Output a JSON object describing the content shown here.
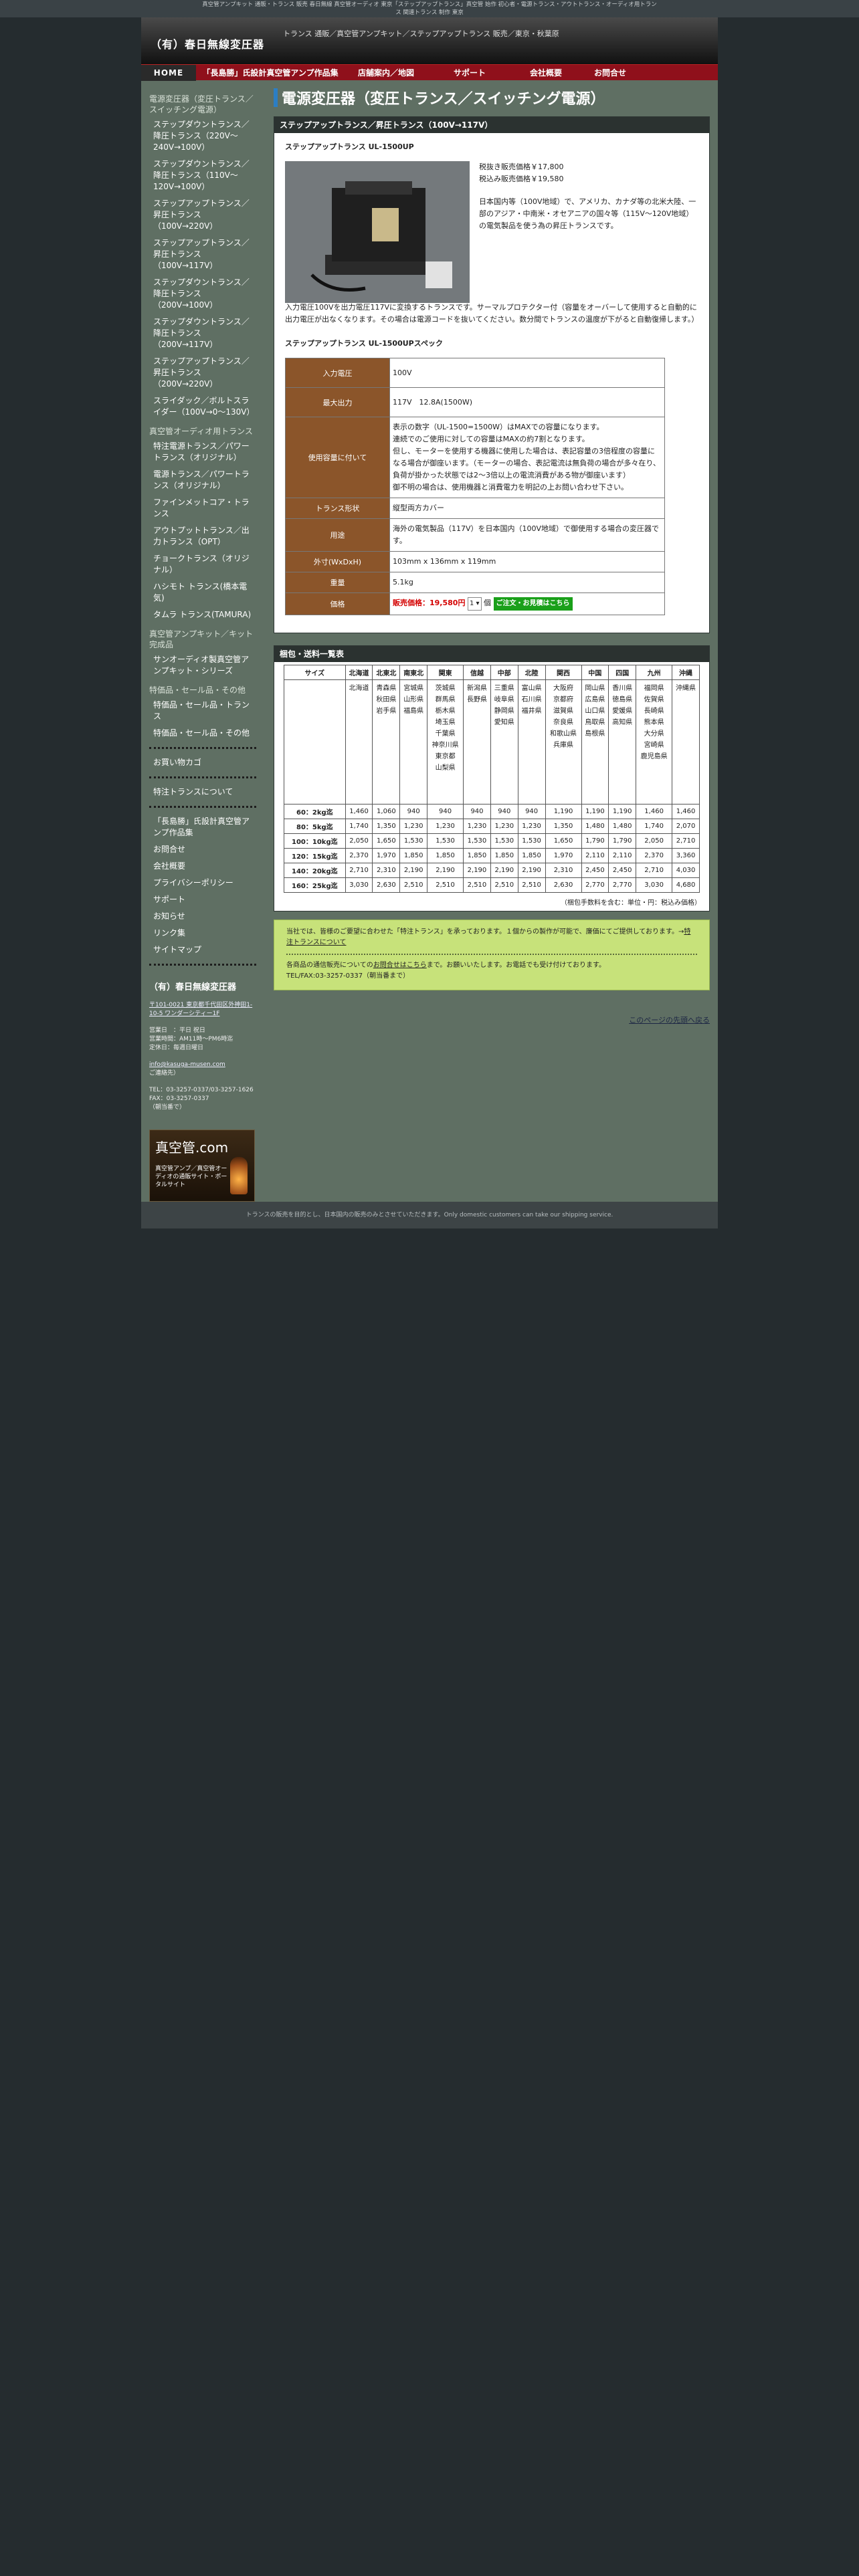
{
  "top_bar": "真空管アンプキット 通販・トランス 販売 春日無線 真空管オーディオ 東京「ステップアップトランス」真空管 始作 初心者・電源トランス・アウトトランス・オーディオ用トランス 関連トランス 制作 東京",
  "site_title": "（有）春日無線変圧器",
  "header_desc": "トランス 通販／真空管アンプキット／ステップアップトランス 販売／東京・秋葉原",
  "nav": [
    "HOME",
    "「長島勝」氏設計真空管アンプ作品集",
    "店舗案内／地図",
    "サポート",
    "会社概要",
    "お問合せ"
  ],
  "sidebar": {
    "sections": [
      {
        "head": "電源変圧器（変圧トランス／スイッチング電源）",
        "items": [
          "ステップダウントランス／降圧トランス（220V〜240V→100V）",
          "ステップダウントランス／降圧トランス（110V〜120V→100V）",
          "ステップアップトランス／昇圧トランス（100V→220V）",
          "ステップアップトランス／昇圧トランス（100V→117V）",
          "ステップダウントランス／降圧トランス（200V→100V）",
          "ステップダウントランス／降圧トランス（200V→117V）",
          "ステップアップトランス／昇圧トランス（200V→220V）",
          "スライダック／ボルトスライダー（100V→0〜130V）"
        ]
      },
      {
        "head": "真空管オーディオ用トランス",
        "items": [
          "特注電源トランス／パワートランス（オリジナル）",
          "電源トランス／パワートランス（オリジナル）",
          "ファインメットコア・トランス",
          "アウトプットトランス／出力トランス（OPT）",
          "チョークトランス（オリジナル）",
          "ハシモト トランス(橋本電気)",
          "タムラ トランス(TAMURA)"
        ]
      },
      {
        "head": "真空管アンプキット／キット完成品",
        "items": [
          "サンオーディオ製真空管アンプキット・シリーズ"
        ]
      },
      {
        "head": "特価品・セール品・その他",
        "items": [
          "特価品・セール品・トランス",
          "特価品・セール品・その他"
        ]
      }
    ],
    "items_after_dots_1": [
      "お買い物カゴ"
    ],
    "items_after_dots_2": [
      "特注トランスについて"
    ],
    "items_after_dots_3": [
      "「長島勝」氏設計真空管アンプ作品集",
      "お問合せ",
      "会社概要",
      "プライバシーポリシー",
      "サポート",
      "お知らせ",
      "リンク集",
      "サイトマップ"
    ],
    "company": {
      "name": "（有）春日無線変圧器",
      "address": "〒101-0021 東京都千代田区外神田1-10-5 ワンダーシティー1F",
      "hours_label": "営業日　：平日 祝日",
      "hours": "営業時間：AM11時〜PM6時迄",
      "holiday": "定休日：毎週日曜日",
      "email": "info@kasuga-musen.com",
      "email_suffix": "ご連絡先）",
      "tel": "TEL：03-3257-0337/03-3257-1626",
      "fax": "FAX：03-3257-0337",
      "fax_note": "（朝当番で）"
    },
    "banner": {
      "title": "真空管.com",
      "sub": "真空管アンプ／真空管オーディオの通販サイト・ポータルサイト"
    }
  },
  "page_title": "電源変圧器（変圧トランス／スイッチング電源）",
  "product": {
    "panel_head": "ステップアップトランス／昇圧トランス（100V→117V）",
    "name": "ステップアップトランス UL-1500UP",
    "price_ex": "税抜き販売価格￥17,800",
    "price_in": "税込み販売価格￥19,580",
    "desc1": "日本国内等（100V地域）で、アメリカ、カナダ等の北米大陸、一部のアジア・中南米・オセアニアの国々等（115V〜120V地域）の電気製品を使う為の昇圧トランスです。",
    "desc2": "入力電圧100Vを出力電圧117Vに変換するトランスです。サーマルプロテクター付（容量をオーバーして使用すると自動的に出力電圧が出なくなります。その場合は電源コードを抜いてください。数分間でトランスの温度が下がると自動復帰します。）",
    "spec_title": "ステップアップトランス UL-1500UPスペック",
    "specs": [
      {
        "label": "入力電圧",
        "value": "100V"
      },
      {
        "label": "最大出力",
        "value": "117V　12.8A(1500W)"
      },
      {
        "label": "使用容量に付いて",
        "value": "表示の数字（UL-1500=1500W）はMAXでの容量になります。\n連続でのご使用に対しての容量はMAXの約7割となります。\n但し、モーターを使用する機器に使用した場合は、表記容量の3倍程度の容量になる場合が御座います。（モーターの場合、表記電流は無負荷の場合が多々在り、負荷が掛かった状態では2〜3倍以上の電流消費がある物が御座います）\n御不明の場合は、使用機器と消費電力を明記の上お問い合わせ下さい。"
      },
      {
        "label": "トランス形状",
        "value": "縦型両方カバー"
      },
      {
        "label": "用途",
        "value": "海外の電気製品（117V）を日本国内（100V地域）で御使用する場合の変圧器です。"
      },
      {
        "label": "外寸(WxDxH)",
        "value": "103mm x 136mm x 119mm"
      },
      {
        "label": "重量",
        "value": "5.1kg"
      }
    ],
    "price_label": "価格",
    "price_text": "販売価格：19,580円",
    "qty": "1",
    "qty_unit": "個",
    "order_button": "ご注文・お見積はこちら"
  },
  "shipping": {
    "panel_head": "梱包・送料一覧表",
    "headers": [
      "サイズ",
      "北海道",
      "北東北",
      "南東北",
      "関東",
      "信越",
      "中部",
      "北陸",
      "関西",
      "中国",
      "四国",
      "九州",
      "沖縄"
    ],
    "regions": [
      "",
      "北海道",
      "青森県\n秋田県\n岩手県",
      "宮城県\n山形県\n福島県",
      "茨城県\n群馬県\n栃木県\n埼玉県\n千葉県\n神奈川県\n東京都\n山梨県",
      "新潟県\n長野県",
      "三重県\n岐阜県\n静岡県\n愛知県",
      "富山県\n石川県\n福井県",
      "大阪府\n京都府\n滋賀県\n奈良県\n和歌山県\n兵庫県",
      "岡山県\n広島県\n山口県\n鳥取県\n島根県",
      "香川県\n徳島県\n愛媛県\n高知県",
      "福岡県\n佐賀県\n長崎県\n熊本県\n大分県\n宮崎県\n鹿児島県",
      "沖縄県"
    ],
    "rows": [
      [
        "60：2kg迄",
        "1,460",
        "1,060",
        "940",
        "940",
        "940",
        "940",
        "940",
        "1,190",
        "1,190",
        "1,190",
        "1,460",
        "1,460"
      ],
      [
        "80：5kg迄",
        "1,740",
        "1,350",
        "1,230",
        "1,230",
        "1,230",
        "1,230",
        "1,230",
        "1,350",
        "1,480",
        "1,480",
        "1,740",
        "2,070"
      ],
      [
        "100：10kg迄",
        "2,050",
        "1,650",
        "1,530",
        "1,530",
        "1,530",
        "1,530",
        "1,530",
        "1,650",
        "1,790",
        "1,790",
        "2,050",
        "2,710"
      ],
      [
        "120：15kg迄",
        "2,370",
        "1,970",
        "1,850",
        "1,850",
        "1,850",
        "1,850",
        "1,850",
        "1,970",
        "2,110",
        "2,110",
        "2,370",
        "3,360"
      ],
      [
        "140：20kg迄",
        "2,710",
        "2,310",
        "2,190",
        "2,190",
        "2,190",
        "2,190",
        "2,190",
        "2,310",
        "2,450",
        "2,450",
        "2,710",
        "4,030"
      ],
      [
        "160：25kg迄",
        "3,030",
        "2,630",
        "2,510",
        "2,510",
        "2,510",
        "2,510",
        "2,510",
        "2,630",
        "2,770",
        "2,770",
        "3,030",
        "4,680"
      ]
    ],
    "note": "（梱包手数料を含む：単位・円：税込み価格）"
  },
  "notice": {
    "line1": "当社では、皆様のご要望に合わせた「特注トランス」を承っております。１個からの製作が可能で、廉価にてご提供しております。→",
    "line1_link": "特注トランスについて",
    "line2a": "各商品の通信販売についての",
    "line2_link": "お問合せはこちら",
    "line2b": "まで。お願いいたします。お電話でも受け付けております。",
    "line3": "TEL/FAX:03-3257-0337（朝当番まで）"
  },
  "back_top": "このページの先頭へ戻る",
  "footer": "トランスの販売を目的とし、日本国内の販売のみとさせていただきます。Only domestic customers can take our shipping service."
}
